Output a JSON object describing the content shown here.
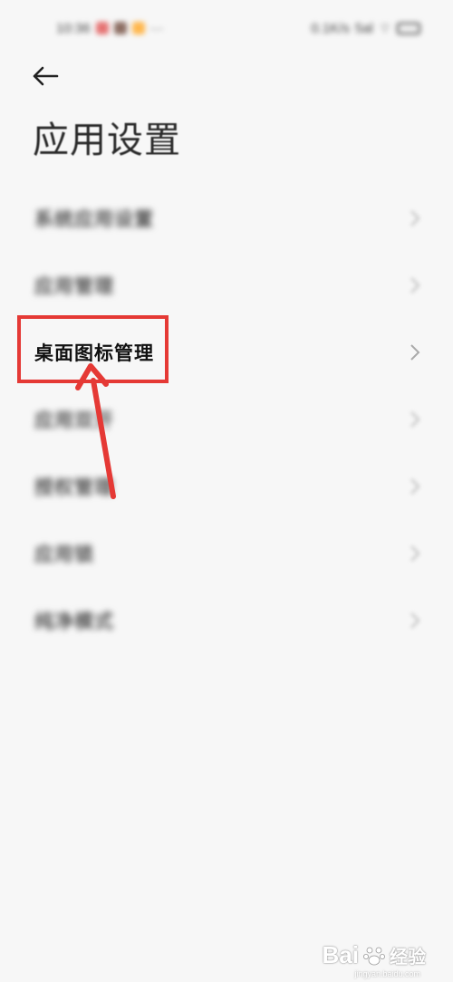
{
  "status_bar": {
    "time": "10:36",
    "more": "···",
    "network_speed": "0.1K/s",
    "signal": "5al",
    "notification_colors": [
      "#e57373",
      "#8d6e63",
      "#ffb74d"
    ]
  },
  "header": {
    "title": "应用设置"
  },
  "menu": {
    "items": [
      {
        "label": "系统应用设置"
      },
      {
        "label": "应用管理"
      },
      {
        "label": "桌面图标管理"
      },
      {
        "label": "应用双开"
      },
      {
        "label": "授权管理"
      },
      {
        "label": "应用锁"
      },
      {
        "label": "纯净模式"
      }
    ]
  },
  "annotation": {
    "color": "#e53935"
  },
  "watermark": {
    "brand": "Bai",
    "brand_suffix": "经验",
    "url": "jingyan.baidu.com"
  }
}
